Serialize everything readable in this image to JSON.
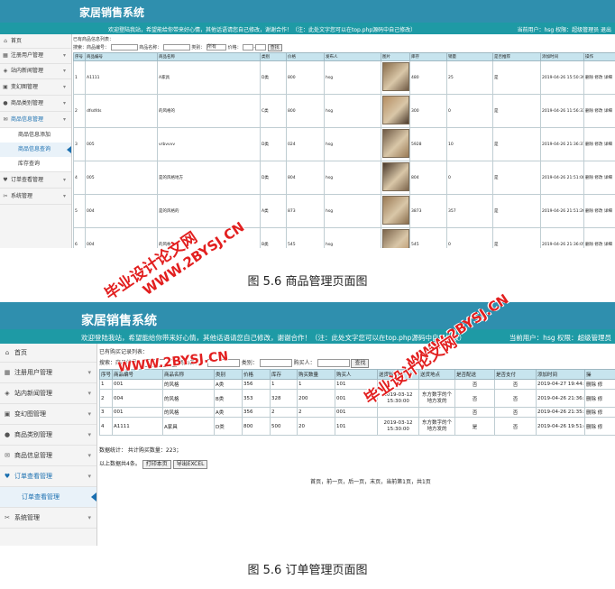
{
  "colors": {
    "header": "#2f8fae",
    "bar": "#1e9aa5",
    "table_head": "#c7e4ee",
    "watermark": "#e21f1f",
    "link": "#1a6fb0"
  },
  "app_title": "家居销售系统",
  "welcome": "欢迎登陆我站，希望能给你带来好心情，其他话语请您自己修改，谢谢合作！（注：此处文字您可以在top.php源码中自己修改）",
  "current_user_1": "当前用户：hsg  权限：超级管理员 退出",
  "current_user_2": "当前用户：hsg 权限：超级管理员",
  "sidebar": [
    {
      "label": "首页",
      "icon": "home-icon"
    },
    {
      "label": "注册用户管理",
      "icon": "users-icon"
    },
    {
      "label": "站内新闻管理",
      "icon": "news-icon"
    },
    {
      "label": "变幻图管理",
      "icon": "image-icon"
    },
    {
      "label": "商品类别管理",
      "icon": "user-icon"
    },
    {
      "label": "商品信息管理",
      "icon": "chat-icon"
    },
    {
      "label": "订单查看管理",
      "icon": "heart-icon"
    },
    {
      "label": "系统管理",
      "icon": "tools-icon"
    }
  ],
  "sub1": [
    "商品信息添加",
    "商品信息查询",
    "库存查询"
  ],
  "sub2": [
    "订单查看管理"
  ],
  "shot1": {
    "crumb": "已有商品信息列表：",
    "search": {
      "l1": "搜索：",
      "l2": "商品编号：",
      "l3": "商品名称：",
      "l4": "类别：",
      "select": "所有",
      "l5": "价格：",
      "sep": "-",
      "btn": "查找"
    },
    "columns": [
      "序号",
      "商品编号",
      "商品名称",
      "类别",
      "价格",
      "发布人",
      "图片",
      "库存",
      "销量",
      "是否推荐",
      "添加时间",
      "操作"
    ],
    "rows": [
      [
        "1",
        "A1111",
        "A家具",
        "D类",
        "800",
        "hsg",
        "",
        "480",
        "25",
        "是",
        "2019-04-26 15:50:39",
        "删除 修改 详细"
      ],
      [
        "2",
        "dfsdfds",
        "的风格的",
        "C类",
        "800",
        "hsg",
        "",
        "300",
        "0",
        "是",
        "2019-04-26 11:56:33",
        "删除 修改 详细"
      ],
      [
        "3",
        "005",
        "vrbvvvv",
        "D类",
        "024",
        "hsg",
        "",
        "5928",
        "10",
        "是",
        "2019-04-26 21:36:37",
        "删除 修改 详细"
      ],
      [
        "4",
        "005",
        "是的风格地方",
        "D类",
        "804",
        "hsg",
        "",
        "804",
        "0",
        "是",
        "2019-04-26 21:51:08",
        "删除 修改 详细"
      ],
      [
        "5",
        "004",
        "是的风格的",
        "A类",
        "873",
        "hsg",
        "",
        "3873",
        "357",
        "是",
        "2019-04-26 21:51:26",
        "删除 修改 详细"
      ],
      [
        "6",
        "004",
        "的风格",
        "B类",
        "545",
        "hsg",
        "",
        "545",
        "0",
        "是",
        "2019-04-26 21:36:05",
        "删除 修改 详细"
      ]
    ],
    "caption": "图 5.6  商品管理页面图"
  },
  "shot2": {
    "crumb": "已有购买记录列表：",
    "search": {
      "l1": "搜索：",
      "l2": "商品编号：",
      "l3": "商品名称：",
      "l4": "类别：",
      "l5": "购买人：",
      "btn": "查找"
    },
    "columns": [
      "序号",
      "商品编号",
      "商品名称",
      "类别",
      "价格",
      "库存",
      "购买数量",
      "购买人",
      "送货时间",
      "送货地点",
      "是否配送",
      "是否支付",
      "添加时间",
      "操"
    ],
    "rows": [
      [
        "1",
        "001",
        "的风格",
        "A类",
        "356",
        "1",
        "1",
        "101",
        "",
        "",
        "否",
        "否",
        "2019-04-27 19:44:15",
        "删除 修"
      ],
      [
        "2",
        "004",
        "的风格",
        "B类",
        "353",
        "328",
        "200",
        "001",
        "2019-03-12 15:30:00",
        "东方数字的个地方发的",
        "否",
        "否",
        "2019-04-26 21:36:36",
        "删除 修"
      ],
      [
        "3",
        "001",
        "的风格",
        "A类",
        "356",
        "2",
        "2",
        "001",
        "",
        "",
        "否",
        "否",
        "2019-04-26 21:35:55",
        "删除 修"
      ],
      [
        "4",
        "A1111",
        "A家具",
        "D类",
        "800",
        "500",
        "20",
        "101",
        "2019-03-12 15:30:00",
        "东方数字的个地方发的",
        "是",
        "否",
        "2019-04-26 19:51:46",
        "删除 修"
      ]
    ],
    "stats": "数据统计：  共计购买数量：223；",
    "total": "以上数据共4条。",
    "print_btn": "打印本页",
    "excel_btn": "导出EXCEL",
    "pager": "首页，前一页，后一页，末页，当前第1页，共1页",
    "caption": "图 5.6  订单管理页面图"
  },
  "watermark": {
    "cn": "毕业设计论文网",
    "url": "WWW.2BYSJ.CN"
  }
}
